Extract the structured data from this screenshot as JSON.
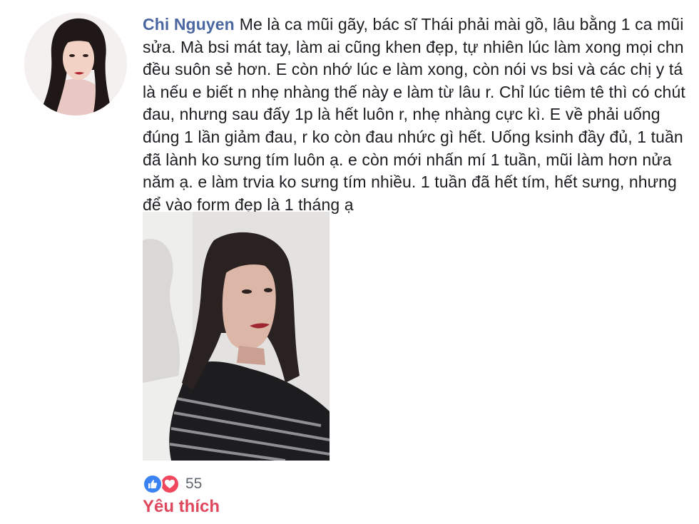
{
  "comment": {
    "author": "Chi Nguyen",
    "text": "Me là ca mũi gãy, bác sĩ Thái phải mài gồ, lâu bằng 1 ca mũi sửa. Mà bsi mát tay, làm ai cũng khen đẹp, tự nhiên lúc làm xong mọi chn đều suôn sẻ hơn. E còn nhớ lúc e làm xong, còn nói vs bsi và các chị y tá là nếu e biết n nhẹ nhàng thế này e làm từ lâu r. Chỉ lúc tiêm tê thì có chút đau, nhưng sau đấy 1p là hết luôn r, nhẹ nhàng cực kì. E về phải uống đúng 1 lần giảm đau, r ko còn đau nhức gì hết. Uống ksinh đầy đủ, 1 tuần đã lành ko sưng tím luôn ạ. e còn mới nhấn mí 1 tuần, mũi làm hơn nửa năm ạ. e làm trvia ko sưng tím nhiều. 1 tuần đã hết tím, hết sưng, nhưng để vào form đẹp là 1 tháng ạ"
  },
  "reactions": {
    "icons": [
      "like-icon",
      "love-icon"
    ],
    "count": "55",
    "like_color": "#3b82f3",
    "love_color": "#f0475d"
  },
  "action": {
    "label": "Yêu thích",
    "color": "#e0475d"
  },
  "colors": {
    "author": "#4b67a1",
    "text": "#1c1e21"
  }
}
